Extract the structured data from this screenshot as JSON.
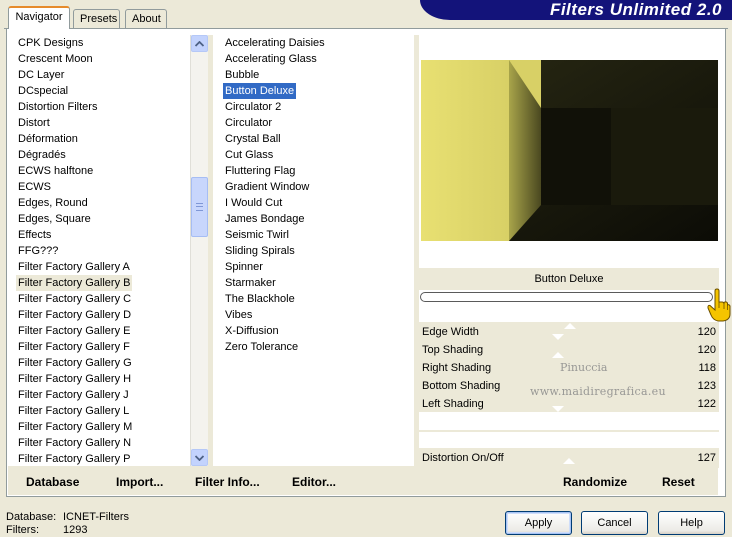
{
  "header": {
    "title": "Filters Unlimited 2.0"
  },
  "tabs": [
    {
      "label": "Navigator",
      "active": true
    },
    {
      "label": "Presets",
      "active": false
    },
    {
      "label": "About",
      "active": false
    }
  ],
  "categories": {
    "items": [
      "CPK Designs",
      "Crescent Moon",
      "DC Layer",
      "DCspecial",
      "Distortion Filters",
      "Distort",
      "Déformation",
      "Dégradés",
      "ECWS halftone",
      "ECWS",
      "Edges, Round",
      "Edges, Square",
      "Effects",
      "FFG???",
      "Filter Factory Gallery A",
      "Filter Factory Gallery B",
      "Filter Factory Gallery C",
      "Filter Factory Gallery D",
      "Filter Factory Gallery E",
      "Filter Factory Gallery F",
      "Filter Factory Gallery G",
      "Filter Factory Gallery H",
      "Filter Factory Gallery J",
      "Filter Factory Gallery L",
      "Filter Factory Gallery M",
      "Filter Factory Gallery N",
      "Filter Factory Gallery P"
    ],
    "selected": "Filter Factory Gallery B"
  },
  "filters": {
    "items": [
      "Accelerating Daisies",
      "Accelerating Glass",
      "Bubble",
      "Button Deluxe",
      "Circulator 2",
      "Circulator",
      "Crystal Ball",
      "Cut Glass",
      "Fluttering Flag",
      "Gradient Window",
      "I Would Cut",
      "James Bondage",
      "Seismic Twirl",
      "Sliding Spirals",
      "Spinner",
      "Starmaker",
      "The Blackhole",
      "Vibes",
      "X-Diffusion",
      "Zero Tolerance"
    ],
    "selected": "Button Deluxe"
  },
  "preview": {
    "filter_name": "Button Deluxe",
    "colors": {
      "face": "#e8e072",
      "dark": "#141408",
      "mid": "#2c2c14",
      "side": "#c8c25c"
    }
  },
  "params": [
    {
      "label": "Edge Width",
      "value": "120"
    },
    {
      "label": "Top Shading",
      "value": "120"
    },
    {
      "label": "Right Shading",
      "value": "118"
    },
    {
      "label": "Bottom Shading",
      "value": "123"
    },
    {
      "label": "Left Shading",
      "value": "122"
    },
    {
      "label": "Distortion On/Off",
      "value": "127"
    }
  ],
  "watermark": {
    "line1": "Pinuccia",
    "line2": "www.maidiregrafica.eu"
  },
  "toolbar": {
    "database": "Database",
    "import": "Import...",
    "filter_info": "Filter Info...",
    "editor": "Editor...",
    "randomize": "Randomize",
    "reset": "Reset"
  },
  "footer": {
    "database_label": "Database:",
    "database_value": "ICNET-Filters",
    "filters_label": "Filters:",
    "filters_value": "1293"
  },
  "buttons": {
    "apply": "Apply",
    "cancel": "Cancel",
    "help": "Help"
  }
}
